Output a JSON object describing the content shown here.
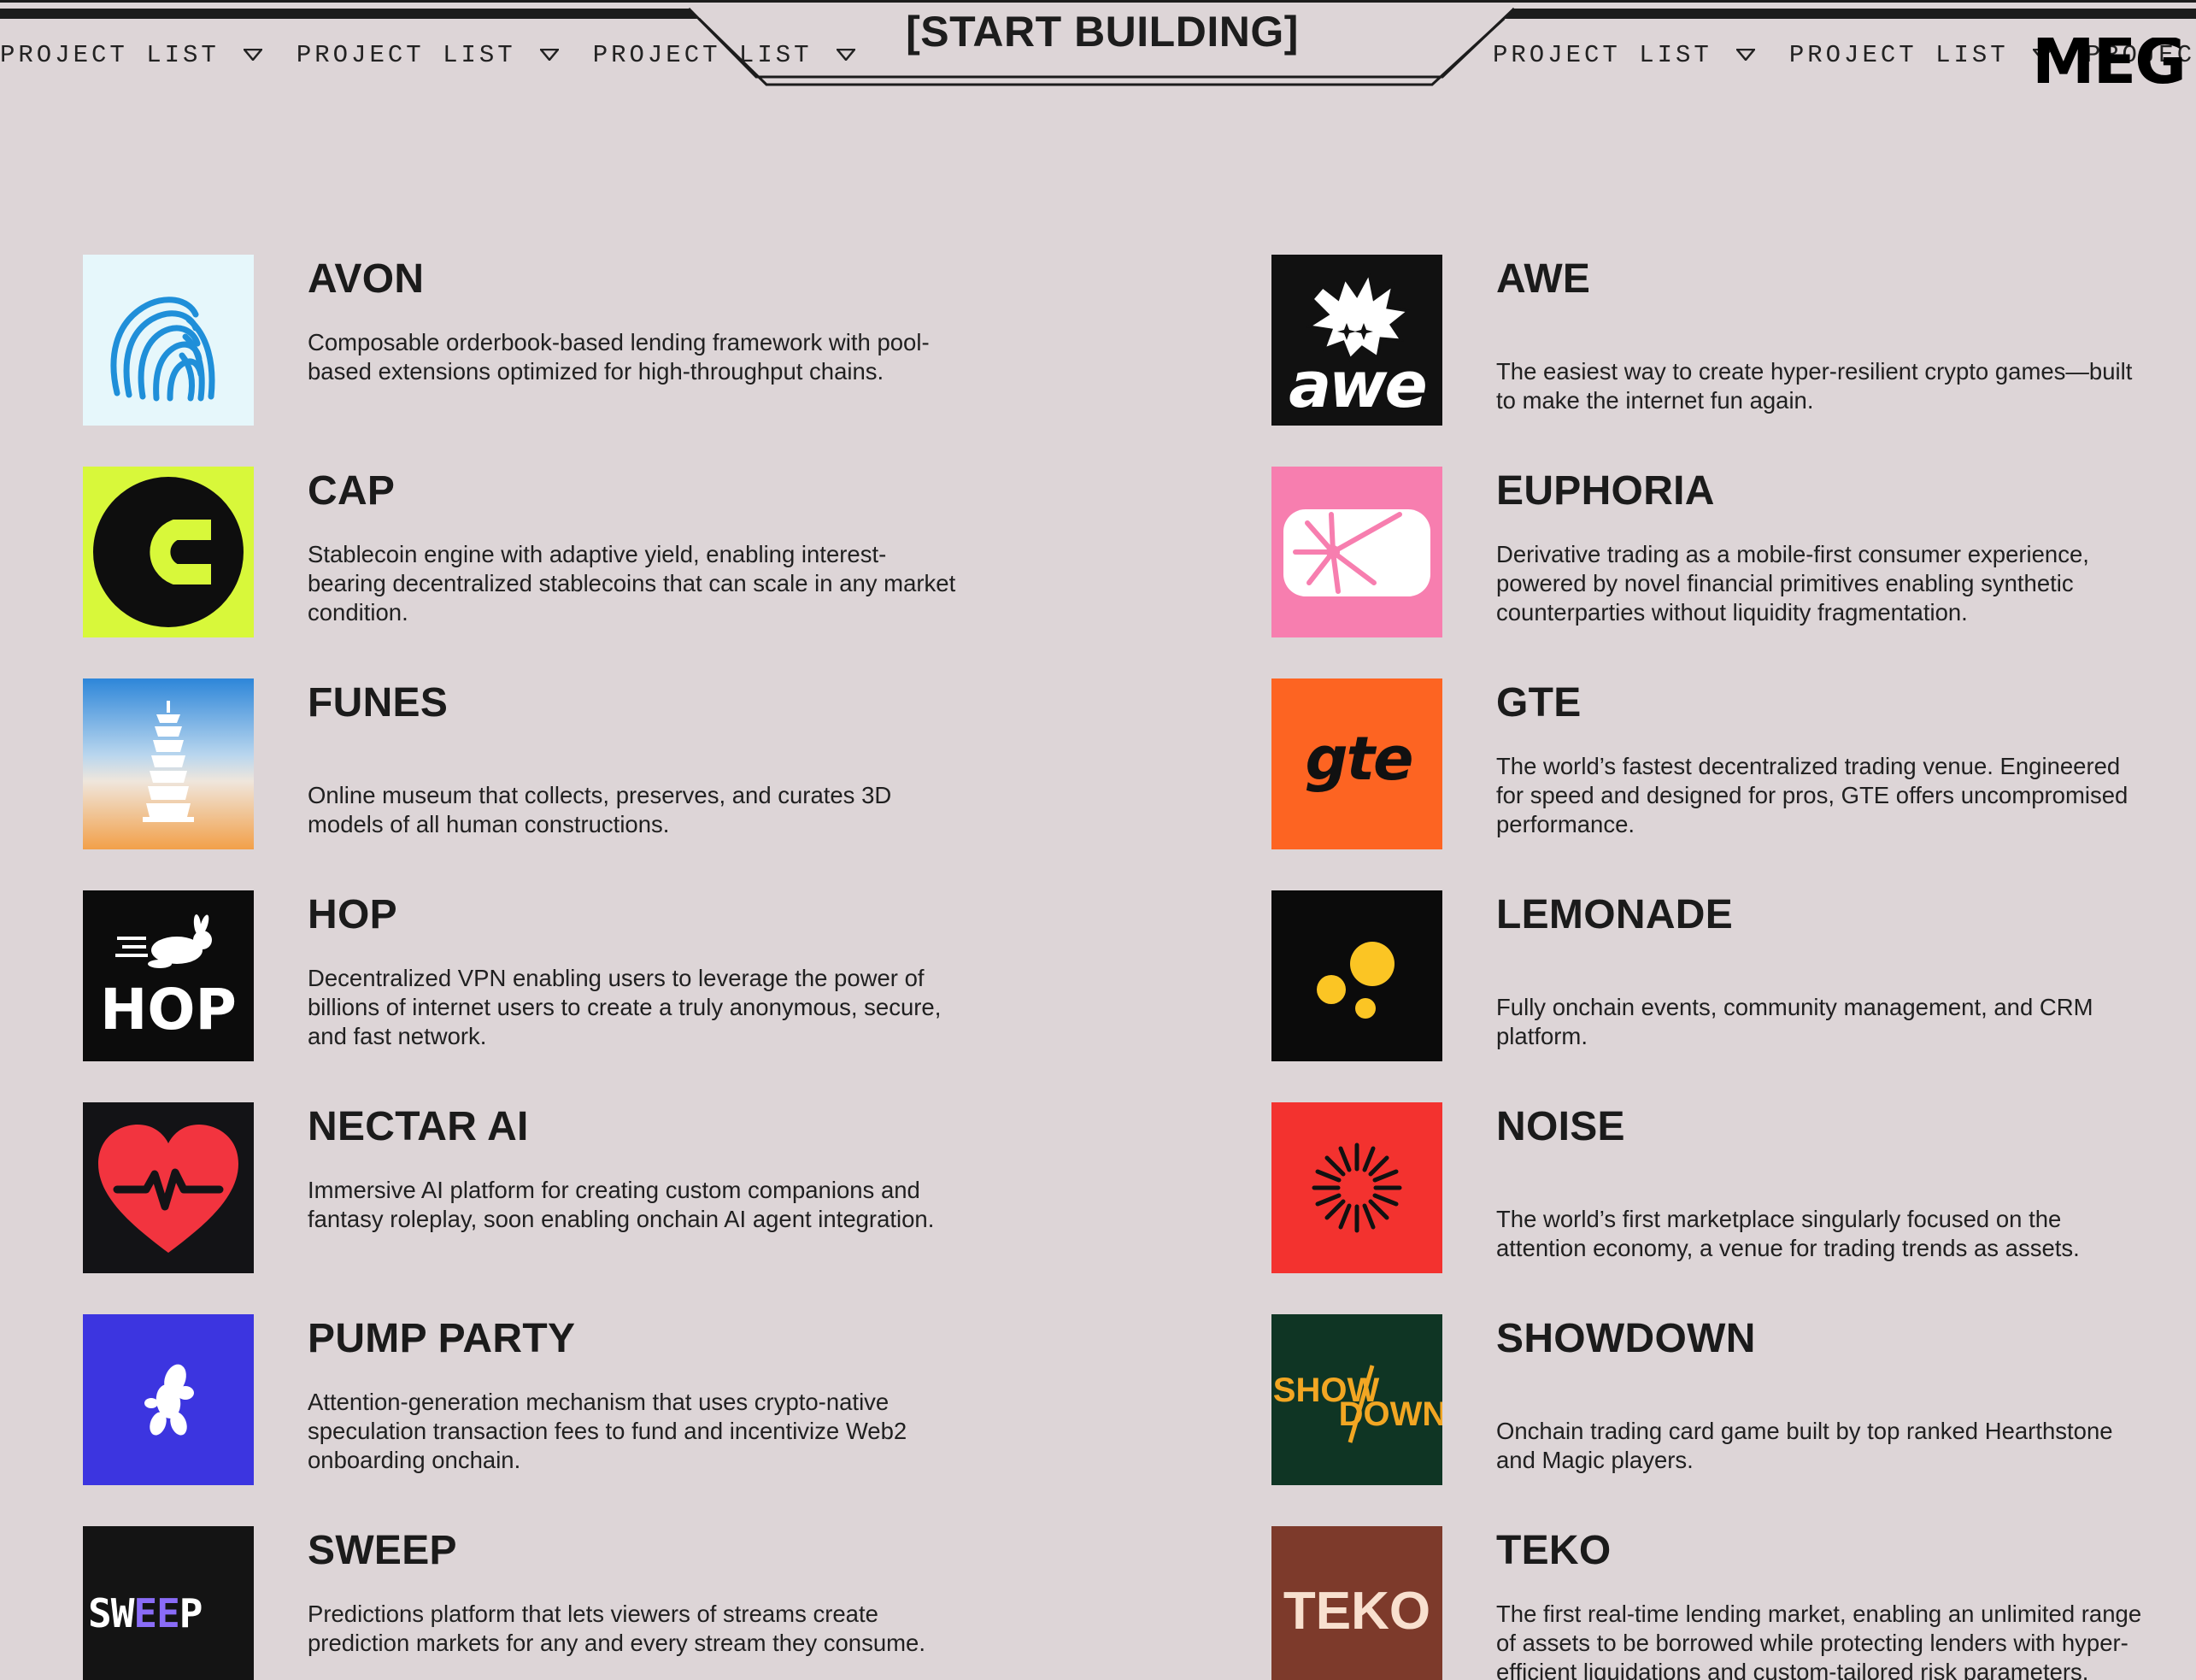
{
  "header": {
    "title": "[START BUILDING]",
    "ticker_label": "PROJECT LIST",
    "ticker_left": [
      "PROJECT LIST",
      "PROJECT LIST",
      "PROJECT LIST"
    ],
    "ticker_right": [
      "PROJECT LIST",
      "PROJECT LIST",
      "PROJECT LIST"
    ],
    "corner_logo": "MEG"
  },
  "projects": {
    "avon": {
      "name": "AVON",
      "description": "Composable orderbook-based lending framework with pool-based extensions optimized for high-throughput chains.",
      "icon": "avon-wave-logo"
    },
    "awe": {
      "name": "AWE",
      "description": "The easiest way to create hyper-resilient crypto games—built to make the internet fun again.",
      "icon": "awe-logo",
      "logo_text": "awe"
    },
    "cap": {
      "name": "CAP",
      "description": "Stablecoin engine with adaptive yield, enabling interest-bearing decentralized stablecoins that can scale in any market condition.",
      "icon": "cap-c-logo"
    },
    "euphoria": {
      "name": "EUPHORIA",
      "description": "Derivative trading as a mobile-first consumer experience, powered by novel financial primitives enabling synthetic counterparties without liquidity fragmentation.",
      "icon": "euphoria-star-logo"
    },
    "funes": {
      "name": "FUNES",
      "description": "Online museum that collects, preserves, and curates 3D models of all human constructions.",
      "icon": "funes-pagoda-logo"
    },
    "gte": {
      "name": "GTE",
      "description": "The world’s fastest decentralized trading venue. Engineered for speed and designed for pros, GTE offers uncompromised performance.",
      "icon": "gte-logo",
      "logo_text": "gte"
    },
    "hop": {
      "name": "HOP",
      "description": "Decentralized VPN enabling users to leverage the power of billions of internet users to create a truly anonymous, secure, and fast network.",
      "icon": "hop-rabbit-logo",
      "logo_text": "HOP"
    },
    "lemonade": {
      "name": "LEMONADE",
      "description": "Fully onchain events, community management, and CRM platform.",
      "icon": "lemonade-dots-logo"
    },
    "nectar": {
      "name": "NECTAR AI",
      "description": "Immersive AI platform for creating custom companions and fantasy roleplay, soon enabling onchain AI agent integration.",
      "icon": "heart-pulse-logo"
    },
    "noise": {
      "name": "NOISE",
      "description": "The world’s first marketplace singularly focused on the attention economy, a venue for trading trends as assets.",
      "icon": "noise-burst-logo"
    },
    "pump": {
      "name": "PUMP PARTY",
      "description": "Attention-generation mechanism that uses crypto-native speculation transaction fees to fund and incentivize Web2 onboarding onchain.",
      "icon": "balloon-dog-logo"
    },
    "showdown": {
      "name": "SHOWDOWN",
      "description": "Onchain trading card game built by top ranked Hearthstone and Magic players.",
      "icon": "showdown-logo",
      "logo_text_top": "SHOW",
      "logo_text_bottom": "DOWN"
    },
    "sweep": {
      "name": "SWEEP",
      "description": "Predictions platform that lets viewers of streams create prediction markets for any and every stream they consume.",
      "icon": "sweep-logo",
      "logo_text_a": "SW",
      "logo_text_b": "EE",
      "logo_text_c": "P"
    },
    "teko": {
      "name": "TEKO",
      "description": "The first real-time lending market, enabling an unlimited range of assets to be borrowed while protecting lenders with hyper-efficient liquidations and custom-tailored risk parameters.",
      "icon": "teko-logo",
      "logo_text": "TEKO"
    }
  }
}
